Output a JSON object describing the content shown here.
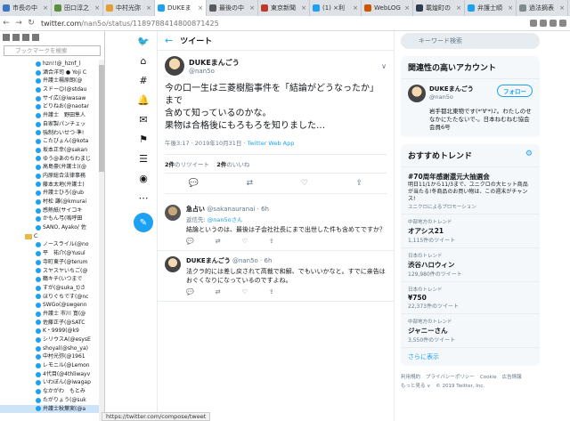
{
  "tabs": [
    {
      "label": "市長の中",
      "color": "#3b78c4"
    },
    {
      "label": "田口淳之",
      "color": "#5a8f3c"
    },
    {
      "label": "中村光弥",
      "color": "#e59e2f"
    },
    {
      "label": "DUKEま",
      "color": "#1da1f2",
      "active": true
    },
    {
      "label": "最後の中",
      "color": "#5a5a5a"
    },
    {
      "label": "東京新聞",
      "color": "#c0392b"
    },
    {
      "label": "(1) ×利",
      "color": "#1da1f2"
    },
    {
      "label": "WebLOG",
      "color": "#d35400"
    },
    {
      "label": "載煌町の",
      "color": "#2c3e50"
    },
    {
      "label": "弁護士順",
      "color": "#1da1f2"
    },
    {
      "label": "過法摘表",
      "color": "#7f8c8d"
    }
  ],
  "address": {
    "host": "twitter.com",
    "path": "/nan5o/status/1189788414800871425"
  },
  "sidebar": {
    "search_placeholder": "ブックマークを検索",
    "items": [
      "hzn!!@_hznf_)",
      "酒合洋司 ● Yoji C",
      "弁護士楊原朗(@",
      "スドー😊(@stdau",
      "サイ広(@iwasaw",
      "どりねお(@naotar",
      "弁護士　野田隼人",
      "自家製パンチェッ",
      "強制わいせつ·準!",
      "こたびょん(@kota",
      "坂本正幸(@sakan",
      "ゆう@あのちわまじ",
      "高島豪(弁護士)(@",
      "内原総合法律事務",
      "藤本太地(弁護士)",
      "弁護士ひろ(@ub",
      "村松 謙(@kmurai",
      "感熱紙(サイコキ",
      "かもん弓(嗚呼田",
      "SANO, Ayako/ 佐",
      "C",
      "ノースライル(@no",
      "平　祐介(@Yusul",
      "寺町東子(@terum",
      "スヤスヤいちご(@",
      "鶴キチ(いつまで",
      "すが(@suka_t)さ",
      "ほりぐちです(@nc",
      "SWGo(@swgenn",
      "弁護士 市川 寛(@",
      "佐藤正子(@SATC",
      "K・9999(@k9",
      "シリウスA(@esysE",
      "shoyal(@sho_ya)",
      "中村光弥(@1961",
      "レモニル(@Lemon",
      "4代目(@4thliwayv",
      "いわぼん(@iwagap",
      "なかがわ　もとみ",
      "たがりょう(@suk",
      "弁護士秋葉実(@a"
    ]
  },
  "header": {
    "title": "ツイート"
  },
  "tweet": {
    "name": "DUKEまんごう",
    "handle": "@nan5o",
    "text_line1": "今の口一生は三菱樹脂事件を「結論がどうなったか」まで",
    "text_line2": "含めて知っているのかな。",
    "text_line3": "果物は合格後にもろもろを知りました…",
    "time": "午後3:17 · 2019年10月31日 · ",
    "app": "Twitter Web App",
    "retweets_num": "2件",
    "retweets_label": "のリツイート",
    "likes_num": "2件",
    "likes_label": "のいいね"
  },
  "replies": [
    {
      "name": "急占い",
      "handle": "@sakanauranai · 6h",
      "reply_to_label": "返信先: ",
      "reply_to": "@nan5oさん",
      "text": "結論というのは、最後は子会社社長にまで出世した件も含めてですか？",
      "counts": [
        "",
        "",
        "",
        ""
      ]
    },
    {
      "name": "DUKEまんごう",
      "handle": "@nan5o · 6h",
      "reply_to_label": "",
      "reply_to": "",
      "text": "法クラ的には差し戻されて高裁で和解、でもいいかなと。すでに亲告はおぐくなりになっているのですよね。",
      "counts": [
        "",
        "",
        "",
        ""
      ]
    }
  ],
  "right": {
    "search_placeholder": "キーワード検索",
    "related_title": "関連性の高いアカウント",
    "account_name": "DUKEまんごう",
    "account_handle": "@nan5o",
    "follow_label": "フォロー",
    "account_bio": "岩手都北東物です(*'∀'*)♪。わたしのせなかにたたないで-。日本ねむねむ協会会員6号",
    "trends_title": "おすすめトレンド",
    "trends": [
      {
        "ctx": "",
        "name": "#70周年感謝還元大抽選会",
        "desc": "明日11/1から11/3まで、ユニクロの大ヒット商品が当たる!冬商品のお買い物は、この週末がチャンス!",
        "promo": "ユニクロによるプロモーション",
        "count": ""
      },
      {
        "ctx": "中部地方のトレンド",
        "name": "オアシス21",
        "desc": "",
        "promo": "",
        "count": "1,115件のツイート"
      },
      {
        "ctx": "日本のトレンド",
        "name": "渋谷ハロウィン",
        "desc": "",
        "promo": "",
        "count": "129,980件のツイート"
      },
      {
        "ctx": "日本のトレンド",
        "name": "¥750",
        "desc": "",
        "promo": "",
        "count": "22,373件のツイート"
      },
      {
        "ctx": "中部地方のトレンド",
        "name": "ジャニーさん",
        "desc": "",
        "promo": "",
        "count": "3,550件のツイート"
      }
    ],
    "show_more": "さらに表示",
    "footer": [
      "利用規約",
      "プライバシーポリシー",
      "Cookie",
      "広告情報",
      "もっと見る ∨",
      "© 2019 Twitter, Inc."
    ]
  },
  "statusbar": "https://twitter.com/compose/tweet"
}
